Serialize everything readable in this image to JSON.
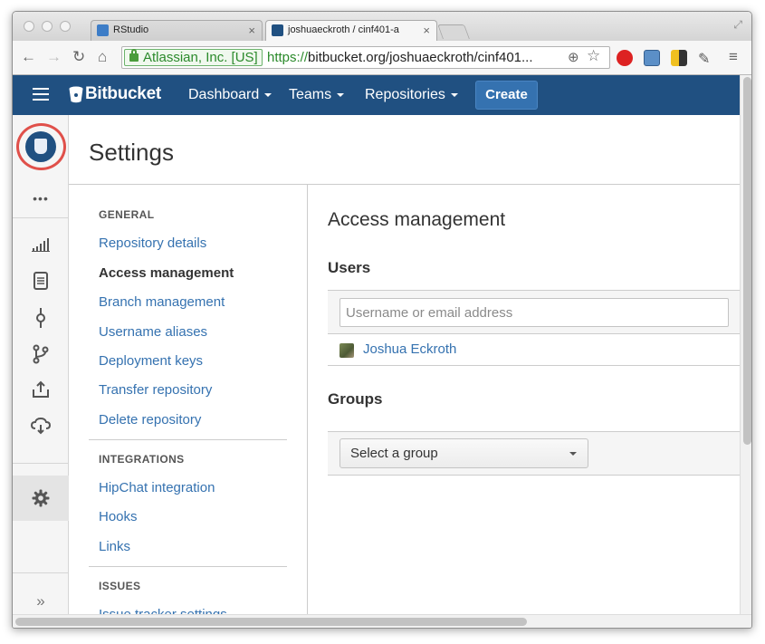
{
  "browser": {
    "tabs": [
      {
        "title": "RStudio",
        "close": "×"
      },
      {
        "title": "joshuaeckroth / cinf401-a",
        "close": "×"
      }
    ],
    "ev_label": "Atlassian, Inc. [US]",
    "url_scheme": "https://",
    "url_rest": "bitbucket.org/joshuaeckroth/cinf401...",
    "back": "←",
    "forward": "→",
    "reload": "↻",
    "home": "⌂",
    "search_glyph": "⊕",
    "star_glyph": "☆",
    "menu_glyph": "≡"
  },
  "header": {
    "logo": "Bitbucket",
    "nav": [
      "Dashboard",
      "Teams",
      "Repositories"
    ],
    "create": "Create"
  },
  "rail": {
    "more": "•••",
    "icons": [
      "overview-icon",
      "source-icon",
      "commits-icon",
      "branches-icon",
      "upload-icon",
      "cloud-download-icon",
      "gear-icon"
    ],
    "expand": "»"
  },
  "page": {
    "title": "Settings"
  },
  "settings_nav": {
    "general_heading": "GENERAL",
    "general": [
      "Repository details",
      "Access management",
      "Branch management",
      "Username aliases",
      "Deployment keys",
      "Transfer repository",
      "Delete repository"
    ],
    "integrations_heading": "INTEGRATIONS",
    "integrations": [
      "HipChat integration",
      "Hooks",
      "Links"
    ],
    "issues_heading": "ISSUES",
    "issues": [
      "Issue tracker settings"
    ]
  },
  "access": {
    "title": "Access management",
    "users_heading": "Users",
    "users_placeholder": "Username or email address",
    "user_name": "Joshua Eckroth",
    "groups_heading": "Groups",
    "group_select": "Select a group"
  },
  "colors": {
    "header_bg": "#205081",
    "link": "#3572b0",
    "highlight_ring": "#e0504a"
  }
}
